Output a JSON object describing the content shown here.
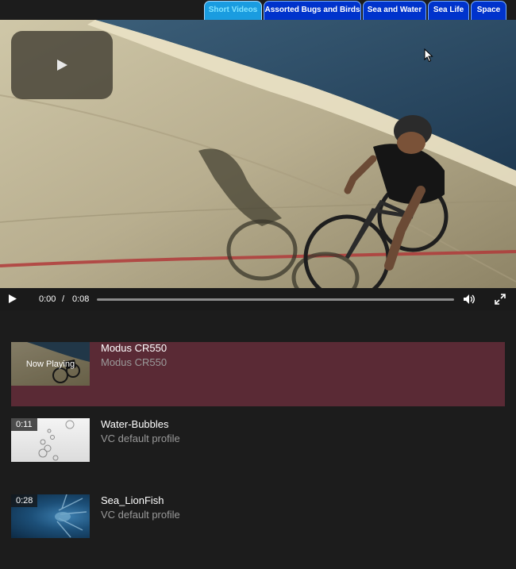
{
  "tabs": [
    {
      "label": "Short Videos",
      "active": true
    },
    {
      "label": "Assorted Bugs and Birds",
      "active": false
    },
    {
      "label": "Sea and Water",
      "active": false
    },
    {
      "label": "Sea Life",
      "active": false
    },
    {
      "label": "Space",
      "active": false
    }
  ],
  "player": {
    "current_time": "0:00",
    "separator": "/",
    "duration": "0:08",
    "progress": 0
  },
  "playlist": [
    {
      "title": "Modus CR550",
      "subtitle": "Modus CR550",
      "overlay": "Now Playing",
      "duration": "",
      "active": true
    },
    {
      "title": "Water-Bubbles",
      "subtitle": "VC default profile",
      "overlay": "",
      "duration": "0:11",
      "active": false
    },
    {
      "title": "Sea_LionFish",
      "subtitle": "VC default profile",
      "overlay": "",
      "duration": "0:28",
      "active": false
    }
  ],
  "colors": {
    "tab_bg": "#0033cc",
    "tab_active_bg": "#1a9ce0",
    "active_item_bg": "#5a2a35",
    "page_bg": "#1c1c1c"
  }
}
